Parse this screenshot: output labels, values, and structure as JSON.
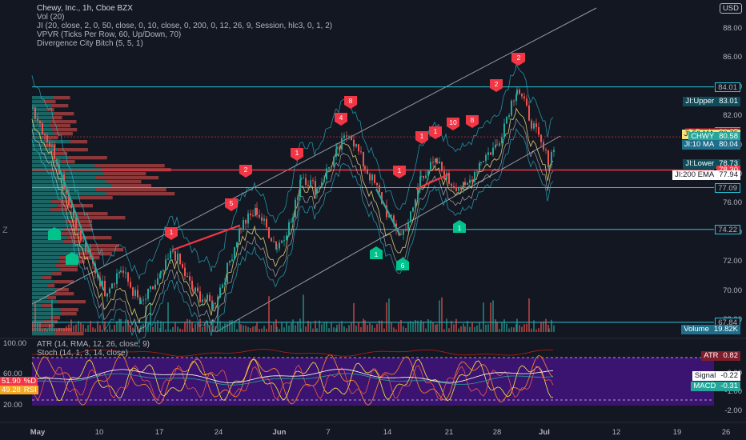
{
  "legend": {
    "symbol_line": "Chewy, Inc., 1h, Cboe BZX",
    "indicators": [
      "Vol (20)",
      "JI (20, close, 2, 0, 50, close, 0, 10, close, 0, 200, 0, 12, 26, 9, Session, hlc3, 0, 1, 2)",
      "VPVR (Ticks Per Row, 60, Up/Down, 70)",
      "Divergence City Bitch (5, 5, 1)"
    ],
    "lower_indicators": [
      "ATR (14, RMA, 12, 26, close, 9)",
      "Stoch (14, 1, 3, 14, close)"
    ]
  },
  "currency": "USD",
  "price_axis": [
    "88.00",
    "86.00",
    "84.00",
    "82.00",
    "80.00",
    "78.00",
    "76.00",
    "74.00",
    "72.00",
    "70.00",
    "68.00"
  ],
  "price_badges": [
    {
      "label": "",
      "value": "84.01",
      "color": "#131722",
      "text": "#b2b5be",
      "border": "#26c6da"
    },
    {
      "label": "JI:Upper",
      "value": "83.01",
      "color": "#0e4c59",
      "text": "#ffffff"
    },
    {
      "label": "",
      "value": "80.92",
      "color": "#131722",
      "text": "#b2b5be",
      "border": "#26c6da"
    },
    {
      "label": "JI:Basis",
      "value": "80.87",
      "color": "#7f1d2b",
      "text": "#ffffff"
    },
    {
      "label": "JI:50 MA",
      "value": "80.75",
      "color": "#f5e27a",
      "text": "#131722"
    },
    {
      "label": "Pre",
      "value": "80.58",
      "color": "#f57c29",
      "text": "#ffffff"
    },
    {
      "label": "CHWY",
      "value": "80.58",
      "color": "#26a69a",
      "text": "#ffffff"
    },
    {
      "label": "JI:10 MA",
      "value": "80.04",
      "color": "#1e6f8c",
      "text": "#ffffff"
    },
    {
      "label": "JI:Lower",
      "value": "78.73",
      "color": "#0e4c59",
      "text": "#ffffff"
    },
    {
      "label": "",
      "value": "78.30",
      "color": "#f23645",
      "text": "#ffffff"
    },
    {
      "label": "JI:200 EMA",
      "value": "77.94",
      "color": "#ffffff",
      "text": "#131722"
    },
    {
      "label": "",
      "value": "77.09",
      "color": "#131722",
      "text": "#b2b5be",
      "border": "#26c6da"
    },
    {
      "label": "",
      "value": "74.22",
      "color": "#131722",
      "text": "#b2b5be",
      "border": "#26c6da"
    },
    {
      "label": "",
      "value": "67.84",
      "color": "#131722",
      "text": "#b2b5be",
      "border": "#26c6da"
    },
    {
      "label": "Volume",
      "value": "19.82K",
      "color": "#1e6f8c",
      "text": "#ffffff"
    }
  ],
  "lower_axis": [
    "0.00",
    "-1.00",
    "-2.00"
  ],
  "lower_badges": [
    {
      "label": "ATR",
      "value": "0.82",
      "color": "#7f1d2b",
      "text": "#ffffff"
    },
    {
      "label": "Signal",
      "value": "-0.22",
      "color": "#ffffff",
      "text": "#131722"
    },
    {
      "label": "MACD",
      "value": "-0.31",
      "color": "#26a69a",
      "text": "#ffffff"
    }
  ],
  "left_axis": [
    "100.00",
    "60.00",
    "20.00"
  ],
  "left_badges": [
    {
      "label": "%D",
      "value": "51.90",
      "color": "#f23645"
    },
    {
      "label": "RSI",
      "value": "49.28",
      "color": "#f5a623"
    }
  ],
  "time_axis": [
    "May",
    "10",
    "17",
    "24",
    "Jun",
    "7",
    "14",
    "21",
    "28",
    "Jul",
    "12",
    "19",
    "26"
  ],
  "markers": {
    "sell": [
      "1",
      "2",
      "5",
      "1",
      "1",
      "4",
      "8",
      "1",
      "1",
      "8",
      "2",
      "10",
      "2",
      "2"
    ],
    "buy": [
      "1",
      "6",
      "1"
    ]
  },
  "colors": {
    "background": "#131722",
    "up": "#26a69a",
    "down": "#ef5350",
    "resistance": "#26c6da",
    "stoch_bg": "#4a148c"
  }
}
